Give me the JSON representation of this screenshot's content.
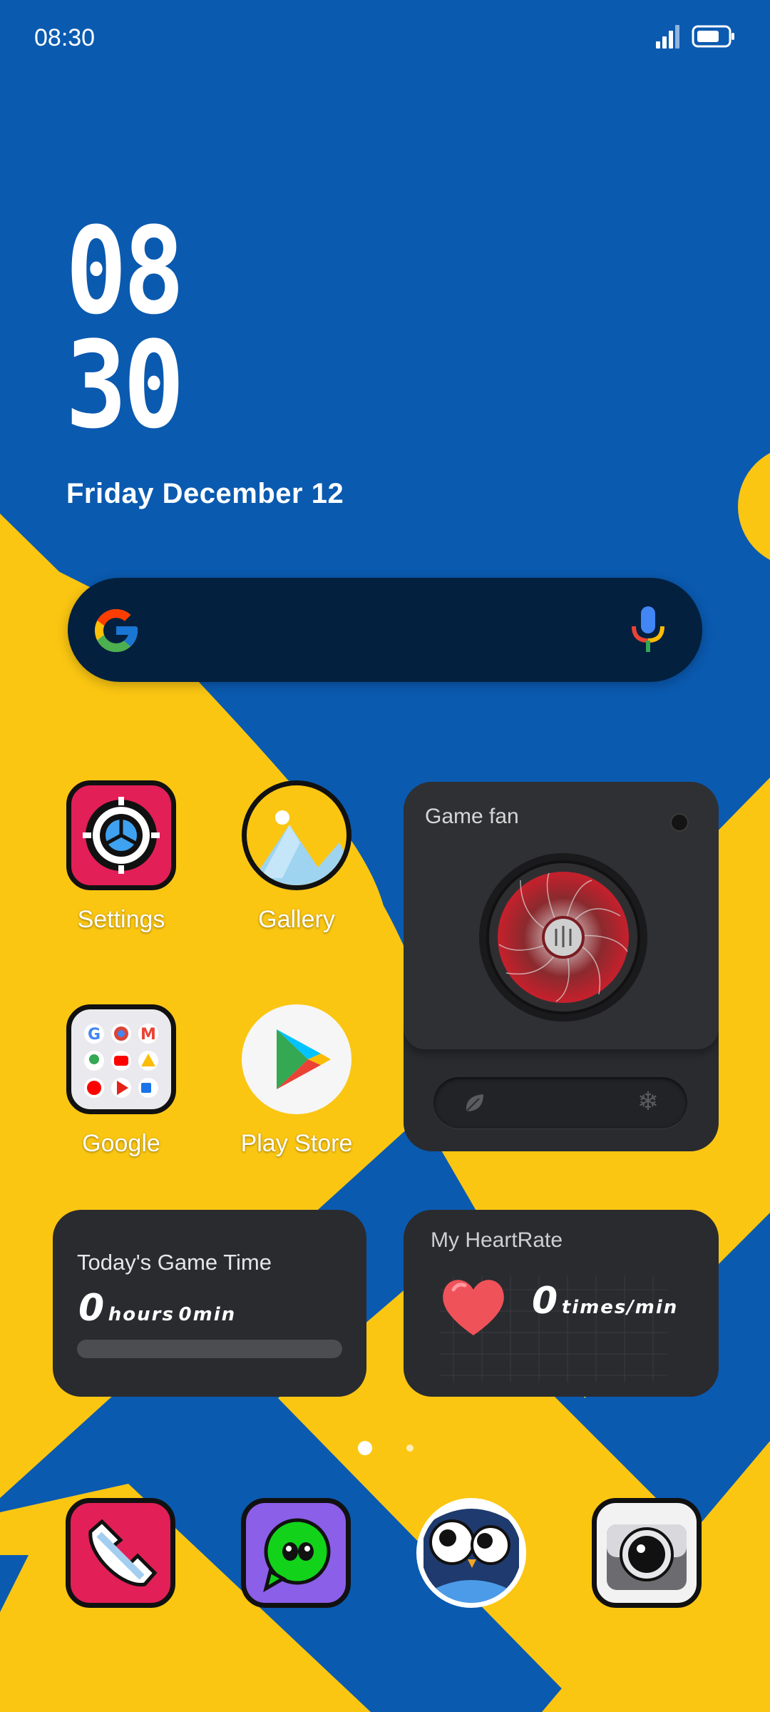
{
  "status_bar": {
    "time": "08:30"
  },
  "clock": {
    "hours": "08",
    "minutes": "30"
  },
  "date": "Friday December 12",
  "search": {
    "google_icon": "google-g-icon",
    "mic_icon": "mic-icon"
  },
  "apps": [
    {
      "label": "Settings",
      "icon": "settings-icon"
    },
    {
      "label": "Gallery",
      "icon": "gallery-icon"
    },
    {
      "label": "Google",
      "icon": "google-folder-icon"
    },
    {
      "label": "Play Store",
      "icon": "play-store-icon"
    }
  ],
  "fan_widget": {
    "title": "Game fan",
    "mode_left": "leaf-icon",
    "mode_right": "snowflake-icon"
  },
  "game_time_widget": {
    "title": "Today's Game Time",
    "hours": "0",
    "hours_unit": "hours",
    "minutes": "0min",
    "progress": 0
  },
  "heartrate_widget": {
    "title": "My HeartRate",
    "value": "0",
    "unit": "times/min"
  },
  "pager": {
    "pages": 2,
    "current": 1
  },
  "dock": [
    {
      "icon": "phone-icon"
    },
    {
      "icon": "messages-icon"
    },
    {
      "icon": "owl-app-icon"
    },
    {
      "icon": "camera-icon"
    }
  ],
  "colors": {
    "wallpaper_blue": "#0a5ab0",
    "wallpaper_yellow": "#fbc612",
    "widget_bg": "#2a2b2f"
  }
}
